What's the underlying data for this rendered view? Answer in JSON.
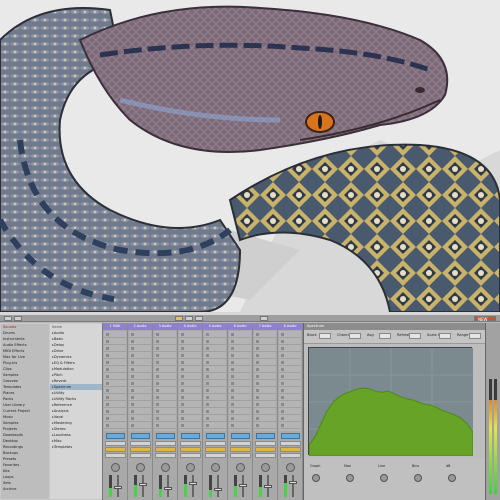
{
  "photo": {
    "subject_icon": "python-snake-photo"
  },
  "daw": {
    "topbar": {
      "right_label": "NEW"
    },
    "browser": {
      "places_rows": [
        "Sounds",
        "Drums",
        "Instruments",
        "Audio Effects",
        "MIDI Effects",
        "Max for Live",
        "Plug-Ins",
        "Clips",
        "Samples",
        "Grooves",
        "Templates",
        "Places",
        "Packs",
        "User Library",
        "Current Project",
        "Music",
        "Samples",
        "Projects",
        "Downloads",
        "Desktop",
        "Recordings",
        "Backups",
        "Presets",
        "Favorites",
        "Kits",
        "Loops",
        "Sets",
        "Archive"
      ],
      "files_rows": [
        "Name",
        "Audio",
        "Basic",
        "Delay",
        "Drive",
        "Dynamics",
        "EQ & Filters",
        "Modulation",
        "Pitch",
        "Reverb",
        "Spectrum",
        "Utility",
        "Utility Racks",
        "Reference",
        "Analysis",
        "Vocal",
        "Mastering",
        "Stereo",
        "Loudness",
        "Misc",
        "Templates"
      ],
      "selected_row": "Spectrum"
    },
    "mixer": {
      "track_names": [
        "1 MIDI",
        "2 Audio",
        "3 Audio",
        "4 Audio",
        "5 Audio",
        "6 Audio",
        "7 Audio",
        "8 Audio"
      ],
      "meter_levels": [
        0.4,
        0.55,
        0.35,
        0.6,
        0.3,
        0.5,
        0.45,
        0.65
      ]
    },
    "device": {
      "title": "Spectrum",
      "ctrl_labels": [
        "Block",
        "Channel",
        "Avg",
        "Refresh",
        "Scale X",
        "Range"
      ],
      "bottom_labels": [
        "Graph",
        "Max",
        "Line",
        "Bins",
        "dB"
      ],
      "spectrum_levels": [
        0.1,
        0.18,
        0.3,
        0.42,
        0.5,
        0.55,
        0.58,
        0.6,
        0.62,
        0.63,
        0.62,
        0.6,
        0.59,
        0.6,
        0.58,
        0.55,
        0.53,
        0.52,
        0.5,
        0.48,
        0.47,
        0.45,
        0.42,
        0.4,
        0.38,
        0.35,
        0.3,
        0.22
      ]
    },
    "master": {
      "level": 0.82
    },
    "colors": {
      "track": "#8f7fd6",
      "spectrum_fill": "#66a326",
      "spectrum_bg": "#7a8a8f"
    }
  }
}
